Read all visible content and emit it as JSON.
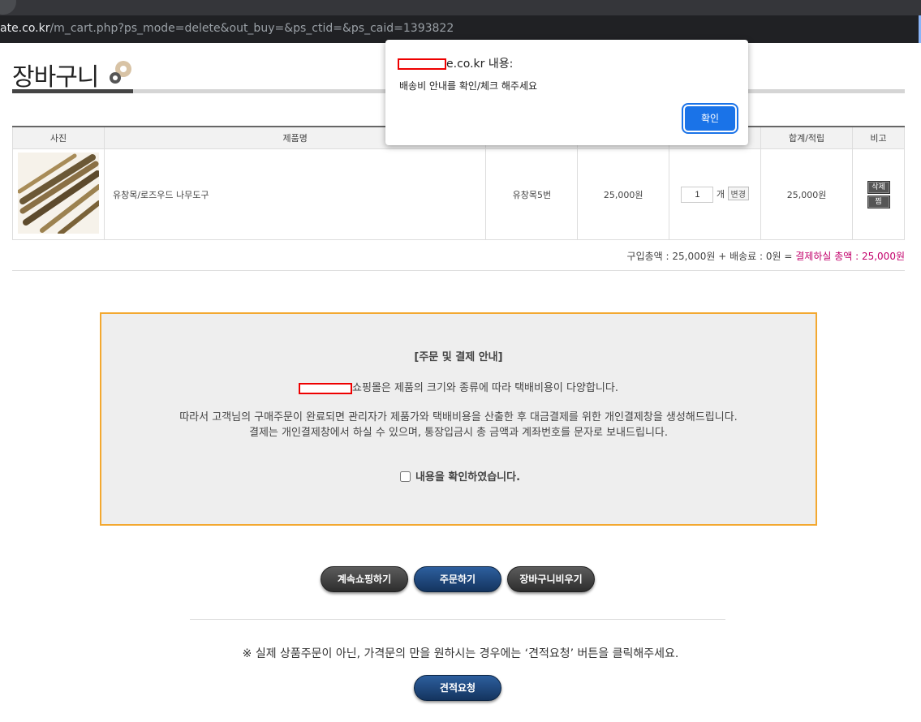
{
  "browser": {
    "url_host": "ate.co.kr",
    "url_path": "/m_cart.php?ps_mode=delete&out_buy=&ps_ctid=&ps_caid=1393822"
  },
  "page": {
    "title": "장바구니"
  },
  "table": {
    "headers": [
      "사진",
      "제품명",
      "",
      "",
      "",
      "합계/적립",
      "비고"
    ],
    "row": {
      "product_name": "유창목/로즈우드 나무도구",
      "option": "유창목5번",
      "price": "25,000원",
      "quantity": "1",
      "qty_unit": "개",
      "change_label": "변경",
      "total": "25,000원",
      "delete_label": "삭제",
      "wish_label": "찜"
    }
  },
  "summary": {
    "text": "구입총액 : 25,000원 + 배송료 : 0원 = ",
    "total_label": "결제하실 총액 : 25,000원"
  },
  "notice": {
    "heading": "[주문 및 결제 안내]",
    "line1": "쇼핑몰은 제품의 크기와 종류에 따라 택배비용이 다양합니다.",
    "line2": "따라서 고객님의 구매주문이 완료되면 관리자가 제품가와 택배비용을 산출한 후 대금결제를 위한 개인결제창을 생성해드립니다.",
    "line3": "결제는 개인결제창에서 하실 수 있으며, 통장입금시 총 금액과 계좌번호를 문자로 보내드립니다.",
    "confirm": "내용을 확인하였습니다."
  },
  "buttons": {
    "continue": "계속쇼핑하기",
    "order": "주문하기",
    "empty": "장바구니비우기",
    "quote": "견적요청"
  },
  "bottom_note": "※ 실제 상품주문이 아닌, 가격문의 만을 원하시는 경우에는 ‘견적요청’ 버튼을 클릭해주세요.",
  "dialog": {
    "title_suffix": "e.co.kr 내용:",
    "message": "배송비 안내를 확인/체크 해주세요",
    "ok": "확인"
  },
  "colors": {
    "accent_pink": "#c2006b",
    "notice_border": "#f3a830",
    "dialog_button": "#1a73e8"
  }
}
